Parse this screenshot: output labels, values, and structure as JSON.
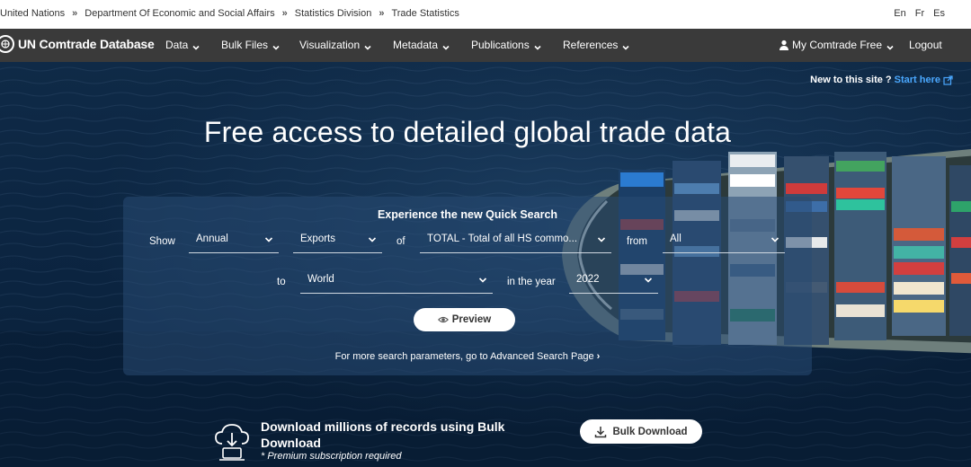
{
  "breadcrumb": {
    "items": [
      "United Nations",
      "Department Of Economic and Social Affairs",
      "Statistics Division",
      "Trade Statistics"
    ],
    "separator": "»"
  },
  "languages": [
    "En",
    "Fr",
    "Es"
  ],
  "nav": {
    "brand": "UN Comtrade Database",
    "items": [
      "Data",
      "Bulk Files",
      "Visualization",
      "Metadata",
      "Publications",
      "References"
    ],
    "user_menu": "My Comtrade Free",
    "logout": "Logout"
  },
  "hero": {
    "new_site_text": "New to this site ?",
    "start_here": "Start here",
    "headline": "Free access to detailed global trade data"
  },
  "quick_search": {
    "title": "Experience the new Quick Search",
    "show_label": "Show",
    "frequency": "Annual",
    "flow": "Exports",
    "of_label": "of",
    "commodity": "TOTAL - Total of all HS commo...",
    "from_label": "from",
    "reporter": "All",
    "to_label": "to",
    "partner": "World",
    "year_label": "in the year",
    "year": "2022",
    "preview_button": "Preview",
    "advanced_link": "For more search parameters, go to Advanced Search Page"
  },
  "bulk": {
    "title": "Download millions of records using Bulk Download",
    "note": "* Premium subscription required",
    "button": "Bulk Download"
  },
  "colors": {
    "topbar_bg": "#ffffff",
    "nav_bg": "#3a3a3a",
    "hero_bg": "#0d2540",
    "link": "#4aa8ff"
  }
}
